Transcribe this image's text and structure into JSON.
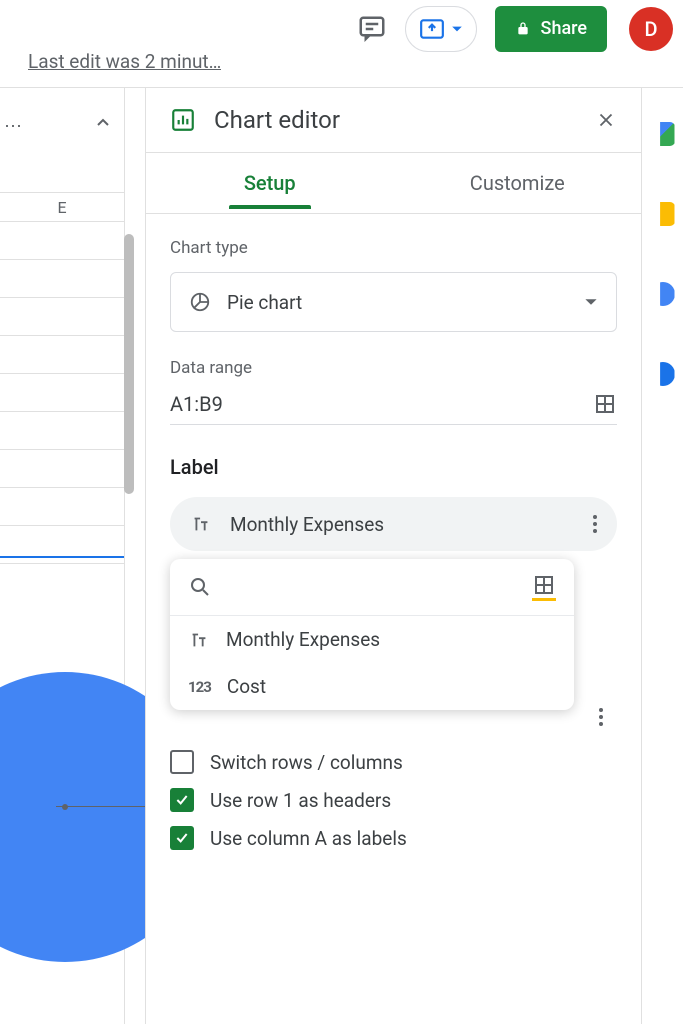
{
  "topbar": {
    "last_edit": "Last edit was 2 minut…",
    "share_label": "Share",
    "avatar_letter": "D"
  },
  "sheet": {
    "column_header": "E"
  },
  "editor": {
    "title": "Chart editor",
    "tabs": {
      "setup": "Setup",
      "customize": "Customize"
    },
    "chart_type_label": "Chart type",
    "chart_type_value": "Pie chart",
    "data_range_label": "Data range",
    "data_range_value": "A1:B9",
    "label_section": "Label",
    "label_pill": "Monthly Expenses",
    "dropdown": {
      "options": [
        {
          "type": "text",
          "label": "Monthly Expenses"
        },
        {
          "type": "number",
          "label": "Cost"
        }
      ]
    },
    "checks": {
      "switch": "Switch rows / columns",
      "headers": "Use row 1 as headers",
      "labels": "Use column A as labels"
    }
  }
}
